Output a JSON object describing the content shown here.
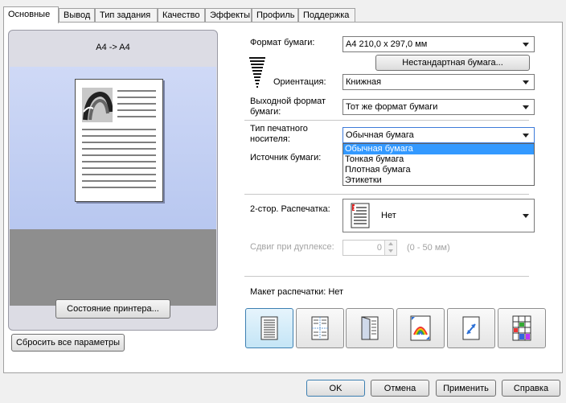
{
  "tabs": [
    {
      "label": "Основные",
      "active": true
    },
    {
      "label": "Вывод"
    },
    {
      "label": "Тип задания"
    },
    {
      "label": "Качество"
    },
    {
      "label": "Эффекты"
    },
    {
      "label": "Профиль"
    },
    {
      "label": "Поддержка"
    }
  ],
  "preview": {
    "title": "A4 -> A4",
    "printer_status_button": "Состояние принтера..."
  },
  "reset_button": "Сбросить все параметры",
  "paper_format": {
    "label": "Формат бумаги:",
    "value": "A4   210,0 x 297,0 мм",
    "custom_button": "Нестандартная бумага..."
  },
  "orientation": {
    "label": "Ориентация:",
    "value": "Книжная"
  },
  "output_format": {
    "label": "Выходной формат бумаги:",
    "value": "Тот же формат бумаги"
  },
  "media_type": {
    "label": "Тип печатного носителя:",
    "value": "Обычная бумага",
    "options": [
      "Обычная бумага",
      "Тонкая бумага",
      "Плотная бумага",
      "Этикетки"
    ],
    "highlighted_index": 0
  },
  "paper_source": {
    "label": "Источник бумаги:"
  },
  "duplex": {
    "label": "2-стор. Распечатка:",
    "value": "Нет"
  },
  "duplex_shift": {
    "label": "Сдвиг при дуплексе:",
    "value": "0",
    "range": "(0 - 50 мм)"
  },
  "layout": {
    "label": "Макет распечатки: Нет"
  },
  "footer": {
    "ok": "OK",
    "cancel": "Отмена",
    "apply": "Применить",
    "help": "Справка"
  },
  "colors": {
    "selection": "#3399ff",
    "active_layout": "#c4e5f6"
  }
}
